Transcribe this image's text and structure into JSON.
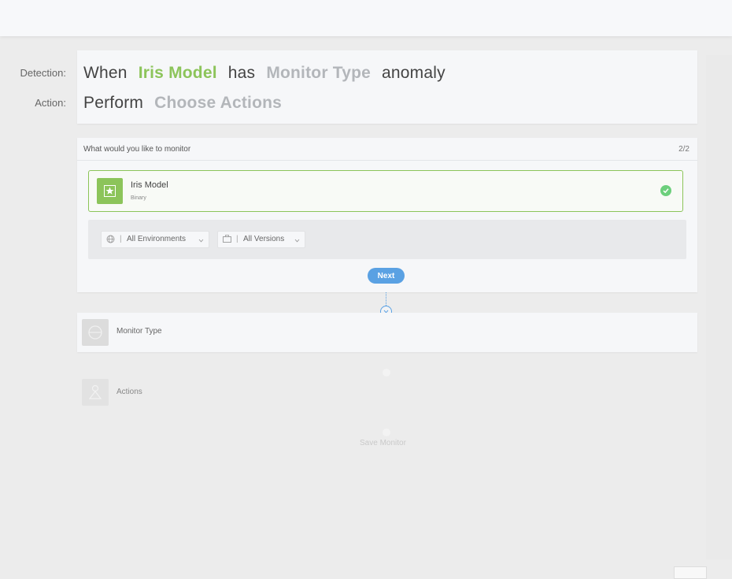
{
  "rows": {
    "detection_label": "Detection:",
    "action_label": "Action:"
  },
  "sentence": {
    "when": "When",
    "model": "Iris Model",
    "has": "has",
    "monitor_type": "Monitor Type",
    "anomaly": "anomaly",
    "perform": "Perform",
    "choose_actions": "Choose Actions"
  },
  "step1": {
    "question": "What would you like to monitor",
    "counter": "2/2",
    "model_name": "Iris Model",
    "model_type": "Binary",
    "env_filter": "All Environments",
    "version_filter": "All Versions",
    "next_label": "Next"
  },
  "step2": {
    "title": "Monitor Type"
  },
  "step3": {
    "title": "Actions"
  },
  "save": {
    "label": "Save Monitor"
  },
  "colors": {
    "accent_green": "#8cc45a",
    "accent_blue": "#5aa1e3",
    "check_green": "#6ccf7c"
  }
}
